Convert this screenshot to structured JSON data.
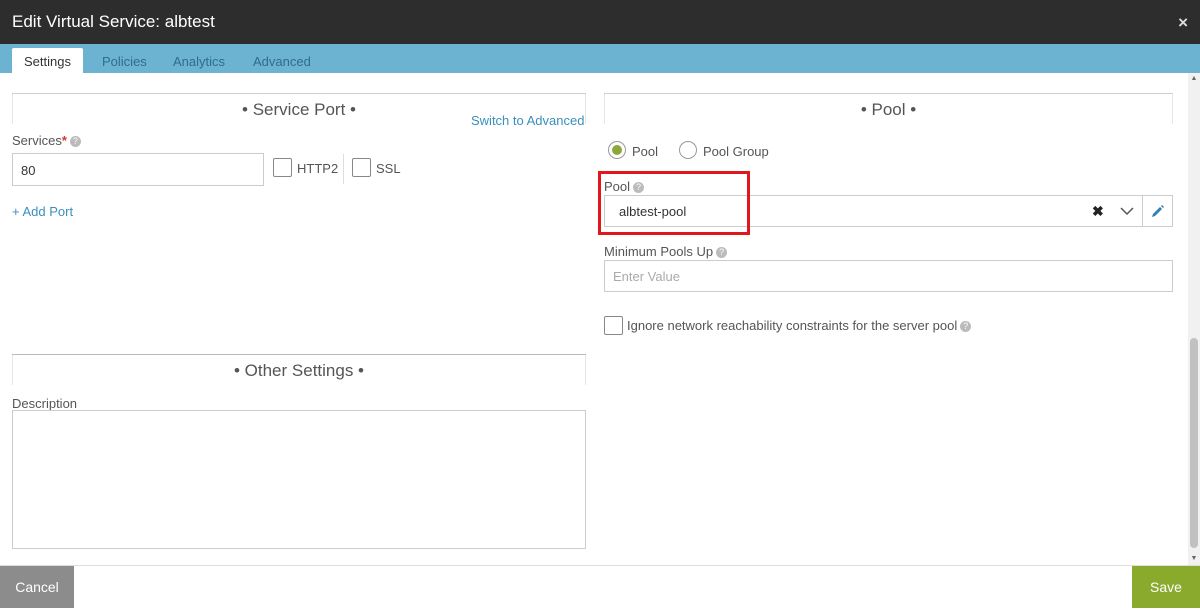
{
  "window": {
    "title": "Edit Virtual Service: albtest",
    "close_icon": "×"
  },
  "tabs": [
    {
      "label": "Settings",
      "active": true
    },
    {
      "label": "Policies",
      "active": false
    },
    {
      "label": "Analytics",
      "active": false
    },
    {
      "label": "Advanced",
      "active": false
    }
  ],
  "service_port": {
    "heading": "• Service Port •",
    "switch_link": "Switch to Advanced",
    "services_label": "Services",
    "required_mark": "*",
    "services_value": "80",
    "http2_label": "HTTP2",
    "http2_checked": false,
    "ssl_label": "SSL",
    "ssl_checked": false,
    "add_port_link": "+ Add Port"
  },
  "other_settings": {
    "heading": "• Other Settings •",
    "description_label": "Description",
    "description_value": ""
  },
  "pool_section": {
    "heading": "• Pool •",
    "radio_pool_label": "Pool",
    "radio_pool_group_label": "Pool Group",
    "selected": "Pool",
    "pool_label": "Pool",
    "pool_value": "albtest-pool",
    "min_pools_label": "Minimum Pools Up",
    "min_pools_placeholder": "Enter Value",
    "ignore_label": "Ignore network reachability constraints for the server pool",
    "ignore_checked": false
  },
  "footer": {
    "cancel_label": "Cancel",
    "save_label": "Save"
  },
  "colors": {
    "title_bar": "#2d2d2d",
    "tab_bar": "#6cb3d1",
    "save_button": "#8aaa2e",
    "cancel_button": "#8c8c8c",
    "highlight": "#e0181d",
    "radio_selected": "#8da73b",
    "link": "#3a8fbd"
  },
  "help_icon_glyph": "?"
}
